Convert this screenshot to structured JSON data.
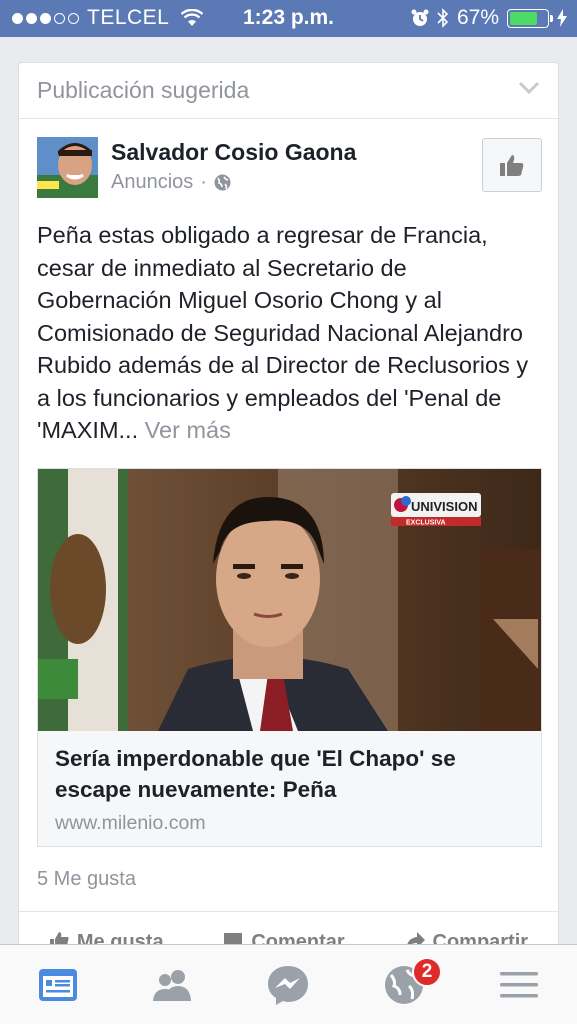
{
  "status_bar": {
    "carrier": "TELCEL",
    "time": "1:23 p.m.",
    "battery": "67%",
    "battery_level": 0.67,
    "signal_bars_filled": 3,
    "signal_bars_total": 5
  },
  "card": {
    "header_label": "Publicación sugerida",
    "author": {
      "name": "Salvador Cosio Gaona",
      "subtitle": "Anuncios",
      "separator": "·"
    },
    "post_text": "Peña estas obligado a regresar de Francia, cesar de inmediato al Secretario de Gobernación Miguel Osorio Chong y al Comisionado de Seguridad Nacional Alejandro Rubido además de al Director de Reclusorios y a los funcionarios y empleados del 'Penal de 'MAXIM...",
    "see_more": "Ver más",
    "link": {
      "image_badge_text": "UNIVISION",
      "image_badge_sub": "EXCLUSIVA",
      "title": "Sería imperdonable que 'El Chapo' se escape nuevamente: Peña",
      "domain": "www.milenio.com"
    },
    "likes_count": "5 Me gusta",
    "actions": [
      "Me gusta",
      "Comentar",
      "Compartir"
    ]
  },
  "tabbar": {
    "tabs": [
      "news-feed",
      "friend-requests",
      "messenger",
      "notifications",
      "more"
    ],
    "notifications_badge": "2"
  },
  "colors": {
    "status_bar": "#5a79b5",
    "accent": "#4267b2",
    "badge": "#e02a2a",
    "battery": "#4cd964"
  }
}
